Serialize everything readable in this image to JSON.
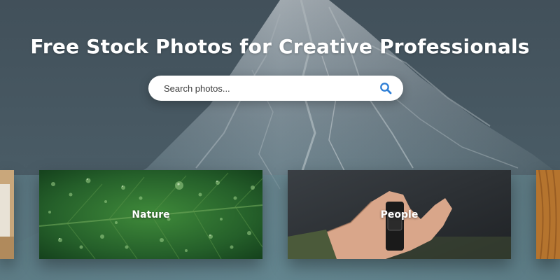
{
  "hero": {
    "headline": "Free Stock Photos for Creative Professionals",
    "background_icon": "mountain-photo"
  },
  "search": {
    "placeholder": "Search photos...",
    "button_icon": "search-icon",
    "accent_color": "#2f7fd6"
  },
  "categories": [
    {
      "label": "",
      "image": "desk-photo"
    },
    {
      "label": "Nature",
      "image": "leaf-water-drops-photo"
    },
    {
      "label": "People",
      "image": "hand-holding-watch-photo"
    },
    {
      "label": "",
      "image": "wood-photo"
    }
  ]
}
